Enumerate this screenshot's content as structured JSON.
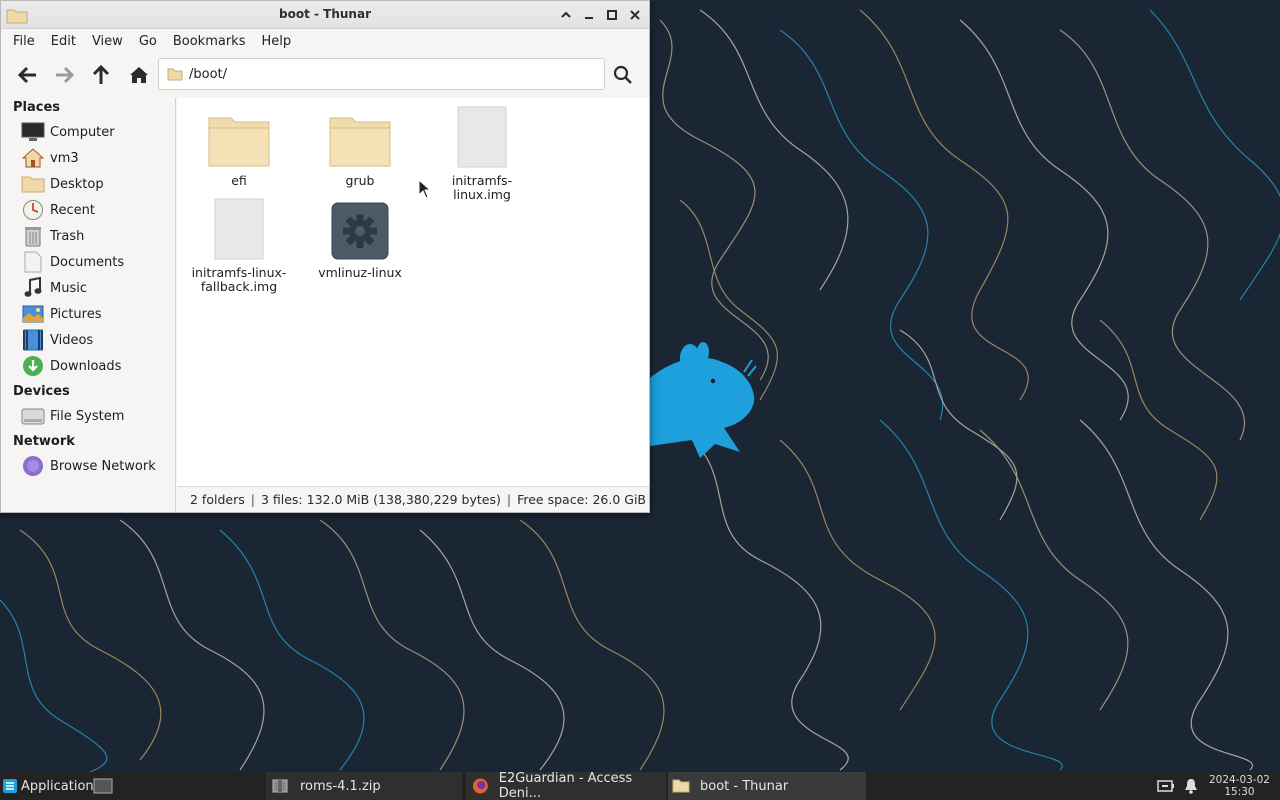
{
  "window": {
    "title": "boot - Thunar",
    "menu": [
      "File",
      "Edit",
      "View",
      "Go",
      "Bookmarks",
      "Help"
    ],
    "path_value": "/boot/"
  },
  "sidebar": {
    "places_header": "Places",
    "places": [
      {
        "label": "Computer",
        "icon": "computer-icon"
      },
      {
        "label": "vm3",
        "icon": "home-icon"
      },
      {
        "label": "Desktop",
        "icon": "desktop-folder-icon"
      },
      {
        "label": "Recent",
        "icon": "recent-icon"
      },
      {
        "label": "Trash",
        "icon": "trash-icon"
      },
      {
        "label": "Documents",
        "icon": "documents-icon"
      },
      {
        "label": "Music",
        "icon": "music-icon"
      },
      {
        "label": "Pictures",
        "icon": "pictures-icon"
      },
      {
        "label": "Videos",
        "icon": "videos-icon"
      },
      {
        "label": "Downloads",
        "icon": "downloads-icon"
      }
    ],
    "devices_header": "Devices",
    "devices": [
      {
        "label": "File System",
        "icon": "drive-icon"
      }
    ],
    "network_header": "Network",
    "network": [
      {
        "label": "Browse Network",
        "icon": "network-icon"
      }
    ]
  },
  "files": [
    {
      "name": "efi",
      "type": "folder"
    },
    {
      "name": "grub",
      "type": "folder"
    },
    {
      "name": "initramfs-linux.img",
      "type": "file"
    },
    {
      "name": "initramfs-linux-fallback.img",
      "type": "file"
    },
    {
      "name": "vmlinuz-linux",
      "type": "executable"
    }
  ],
  "status": {
    "folders": "2 folders",
    "files": "3 files: 132.0 MiB (138,380,229 bytes)",
    "free": "Free space: 26.0 GiB"
  },
  "taskbar": {
    "applications": "Applications",
    "tasks": [
      "roms-4.1.zip",
      "E2Guardian - Access Deni...",
      "boot - Thunar"
    ],
    "date": "2024-03-02",
    "time": "15:30"
  },
  "colors": {
    "accent_blue": "#1ea0dc",
    "folder": "#f0d9a8",
    "wallpaper": "#1a2634"
  }
}
